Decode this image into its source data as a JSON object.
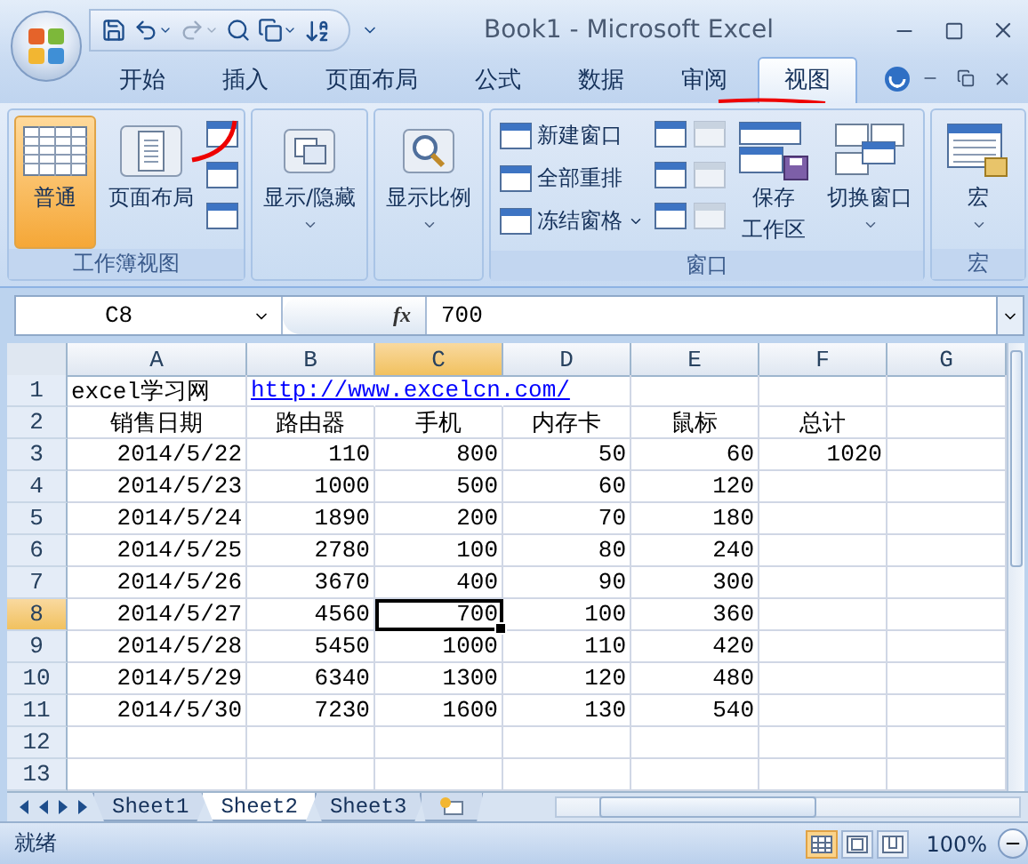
{
  "window": {
    "title": "Book1 - Microsoft Excel"
  },
  "ribbon_tabs": [
    {
      "label": "开始",
      "selected": false
    },
    {
      "label": "插入",
      "selected": false
    },
    {
      "label": "页面布局",
      "selected": false
    },
    {
      "label": "公式",
      "selected": false
    },
    {
      "label": "数据",
      "selected": false
    },
    {
      "label": "审阅",
      "selected": false
    },
    {
      "label": "视图",
      "selected": true
    }
  ],
  "ribbon_groups": [
    {
      "label": "工作簿视图",
      "items": [
        {
          "kind": "large",
          "lines": [
            "普通"
          ],
          "selected": true,
          "dropdown": false
        },
        {
          "kind": "large",
          "lines": [
            "页面布局"
          ],
          "selected": false,
          "dropdown": false
        },
        {
          "kind": "icon_column",
          "disabled": false
        }
      ]
    },
    {
      "items": [
        {
          "kind": "large",
          "lines": [
            "显示/隐藏"
          ],
          "selected": false,
          "dropdown": true
        }
      ]
    },
    {
      "items": [
        {
          "kind": "large",
          "lines": [
            "显示比例"
          ],
          "selected": false,
          "dropdown": true
        }
      ]
    },
    {
      "label": "窗口",
      "items": [
        {
          "kind": "small_column",
          "entries": [
            {
              "label": "新建窗口",
              "dropdown": false
            },
            {
              "label": "全部重排",
              "dropdown": false
            },
            {
              "label": "冻结窗格",
              "dropdown": true
            }
          ]
        },
        {
          "kind": "icon_column",
          "disabled": false
        },
        {
          "kind": "icon_column",
          "disabled": true
        },
        {
          "kind": "large",
          "lines": [
            "保存",
            "工作区"
          ],
          "selected": false,
          "dropdown": false
        },
        {
          "kind": "large",
          "lines": [
            "切换窗口"
          ],
          "selected": false,
          "dropdown": true
        }
      ]
    },
    {
      "label": "宏",
      "items": [
        {
          "kind": "large",
          "lines": [
            "宏"
          ],
          "selected": false,
          "dropdown": true
        }
      ]
    }
  ],
  "formula_bar": {
    "name_box": "C8",
    "function_label": "fx",
    "value": "700"
  },
  "columns": [
    {
      "label": "A",
      "selected": false
    },
    {
      "label": "B",
      "selected": false
    },
    {
      "label": "C",
      "selected": true
    },
    {
      "label": "D",
      "selected": false
    },
    {
      "label": "E",
      "selected": false
    },
    {
      "label": "F",
      "selected": false
    },
    {
      "label": "G",
      "selected": false
    }
  ],
  "rows": [
    {
      "label": "1",
      "selected": false,
      "cells": [
        {
          "text": "excel学习网",
          "kind": "text"
        },
        {
          "text": "http://www.excelcn.com/",
          "kind": "link"
        },
        null,
        null,
        null,
        null,
        null
      ]
    },
    {
      "label": "2",
      "selected": false,
      "cells": [
        {
          "text": "销售日期",
          "kind": "header"
        },
        {
          "text": "路由器",
          "kind": "header"
        },
        {
          "text": "手机",
          "kind": "header"
        },
        {
          "text": "内存卡",
          "kind": "header"
        },
        {
          "text": "鼠标",
          "kind": "header"
        },
        {
          "text": "总计",
          "kind": "header"
        },
        null
      ]
    },
    {
      "label": "3",
      "selected": false,
      "cells": [
        {
          "text": "2014/5/22",
          "kind": "number"
        },
        {
          "text": "110",
          "kind": "number"
        },
        {
          "text": "800",
          "kind": "number"
        },
        {
          "text": "50",
          "kind": "number"
        },
        {
          "text": "60",
          "kind": "number"
        },
        {
          "text": "1020",
          "kind": "number"
        },
        null
      ]
    },
    {
      "label": "4",
      "selected": false,
      "cells": [
        {
          "text": "2014/5/23",
          "kind": "number"
        },
        {
          "text": "1000",
          "kind": "number"
        },
        {
          "text": "500",
          "kind": "number"
        },
        {
          "text": "60",
          "kind": "number"
        },
        {
          "text": "120",
          "kind": "number"
        },
        null,
        null
      ]
    },
    {
      "label": "5",
      "selected": false,
      "cells": [
        {
          "text": "2014/5/24",
          "kind": "number"
        },
        {
          "text": "1890",
          "kind": "number"
        },
        {
          "text": "200",
          "kind": "number"
        },
        {
          "text": "70",
          "kind": "number"
        },
        {
          "text": "180",
          "kind": "number"
        },
        null,
        null
      ]
    },
    {
      "label": "6",
      "selected": false,
      "cells": [
        {
          "text": "2014/5/25",
          "kind": "number"
        },
        {
          "text": "2780",
          "kind": "number"
        },
        {
          "text": "100",
          "kind": "number"
        },
        {
          "text": "80",
          "kind": "number"
        },
        {
          "text": "240",
          "kind": "number"
        },
        null,
        null
      ]
    },
    {
      "label": "7",
      "selected": false,
      "cells": [
        {
          "text": "2014/5/26",
          "kind": "number"
        },
        {
          "text": "3670",
          "kind": "number"
        },
        {
          "text": "400",
          "kind": "number"
        },
        {
          "text": "90",
          "kind": "number"
        },
        {
          "text": "300",
          "kind": "number"
        },
        null,
        null
      ]
    },
    {
      "label": "8",
      "selected": true,
      "cells": [
        {
          "text": "2014/5/27",
          "kind": "number"
        },
        {
          "text": "4560",
          "kind": "number"
        },
        {
          "text": "700",
          "kind": "number"
        },
        {
          "text": "100",
          "kind": "number"
        },
        {
          "text": "360",
          "kind": "number"
        },
        null,
        null
      ]
    },
    {
      "label": "9",
      "selected": false,
      "cells": [
        {
          "text": "2014/5/28",
          "kind": "number"
        },
        {
          "text": "5450",
          "kind": "number"
        },
        {
          "text": "1000",
          "kind": "number"
        },
        {
          "text": "110",
          "kind": "number"
        },
        {
          "text": "420",
          "kind": "number"
        },
        null,
        null
      ]
    },
    {
      "label": "10",
      "selected": false,
      "cells": [
        {
          "text": "2014/5/29",
          "kind": "number"
        },
        {
          "text": "6340",
          "kind": "number"
        },
        {
          "text": "1300",
          "kind": "number"
        },
        {
          "text": "120",
          "kind": "number"
        },
        {
          "text": "480",
          "kind": "number"
        },
        null,
        null
      ]
    },
    {
      "label": "11",
      "selected": false,
      "cells": [
        {
          "text": "2014/5/30",
          "kind": "number"
        },
        {
          "text": "7230",
          "kind": "number"
        },
        {
          "text": "1600",
          "kind": "number"
        },
        {
          "text": "130",
          "kind": "number"
        },
        {
          "text": "540",
          "kind": "number"
        },
        null,
        null
      ]
    },
    {
      "label": "12",
      "selected": false,
      "cells": [
        null,
        null,
        null,
        null,
        null,
        null,
        null
      ]
    },
    {
      "label": "13",
      "selected": false,
      "cells": [
        null,
        null,
        null,
        null,
        null,
        null,
        null
      ]
    }
  ],
  "sheet_tabs": [
    {
      "label": "Sheet1",
      "selected": false
    },
    {
      "label": "Sheet2",
      "selected": true
    },
    {
      "label": "Sheet3",
      "selected": false
    }
  ],
  "status_bar": {
    "status": "就绪",
    "views": [
      {
        "selected": true
      },
      {
        "selected": false
      },
      {
        "selected": false
      }
    ],
    "zoom": "100%"
  }
}
